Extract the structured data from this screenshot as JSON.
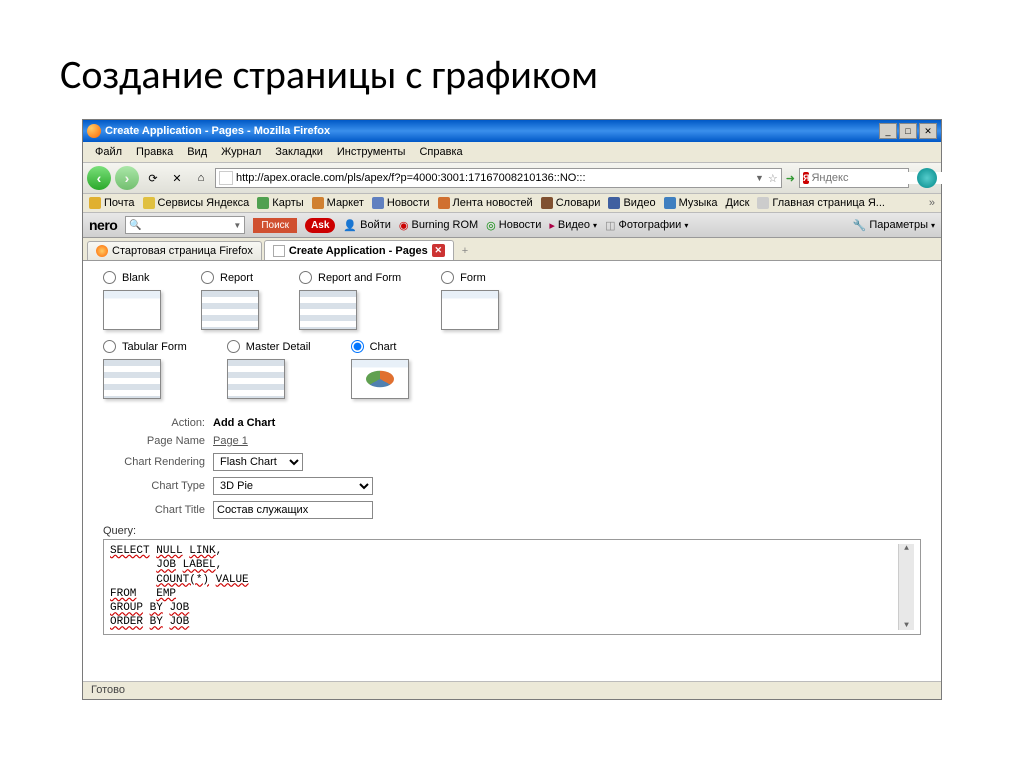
{
  "slide": {
    "title": "Создание страницы с графиком"
  },
  "window": {
    "title": "Create Application - Pages - Mozilla Firefox"
  },
  "menu": {
    "file": "Файл",
    "edit": "Правка",
    "view": "Вид",
    "history": "Журнал",
    "bookmarks": "Закладки",
    "tools": "Инструменты",
    "help": "Справка"
  },
  "address": {
    "url": "http://apex.oracle.com/pls/apex/f?p=4000:3001:17167008210136::NO:::",
    "search_placeholder": "Яндекс",
    "search_badge": "Я"
  },
  "bookmarks": {
    "mail": "Почта",
    "yandex_services": "Сервисы Яндекса",
    "maps": "Карты",
    "market": "Маркет",
    "news": "Новости",
    "news_feed": "Лента новостей",
    "dicts": "Словари",
    "video": "Видео",
    "music": "Музыка",
    "disk": "Диск",
    "yandex_home": "Главная страница Я..."
  },
  "nero": {
    "logo": "nero",
    "search_btn": "Поиск",
    "ask": "Ask",
    "login": "Войти",
    "burning": "Burning ROM",
    "news": "Новости",
    "video": "Видео",
    "photos": "Фотографии",
    "params": "Параметры"
  },
  "tabs": {
    "t1": "Стартовая страница Firefox",
    "t2": "Create Application - Pages"
  },
  "page_types": {
    "blank": "Blank",
    "report": "Report",
    "report_form": "Report and Form",
    "form": "Form",
    "tabular": "Tabular Form",
    "master_detail": "Master Detail",
    "chart": "Chart"
  },
  "form": {
    "action_label": "Action:",
    "action_value": "Add a Chart",
    "pagename_label": "Page Name",
    "pagename_value": "Page 1",
    "rendering_label": "Chart Rendering",
    "rendering_value": "Flash Chart",
    "charttype_label": "Chart Type",
    "charttype_value": "3D Pie",
    "charttitle_label": "Chart Title",
    "charttitle_value": "Состав служащих",
    "query_label": "Query:",
    "query_text": "SELECT NULL LINK,\n       JOB LABEL,\n       COUNT(*) VALUE\nFROM   EMP\nGROUP BY JOB\nORDER BY JOB"
  },
  "status": {
    "text": "Готово"
  }
}
